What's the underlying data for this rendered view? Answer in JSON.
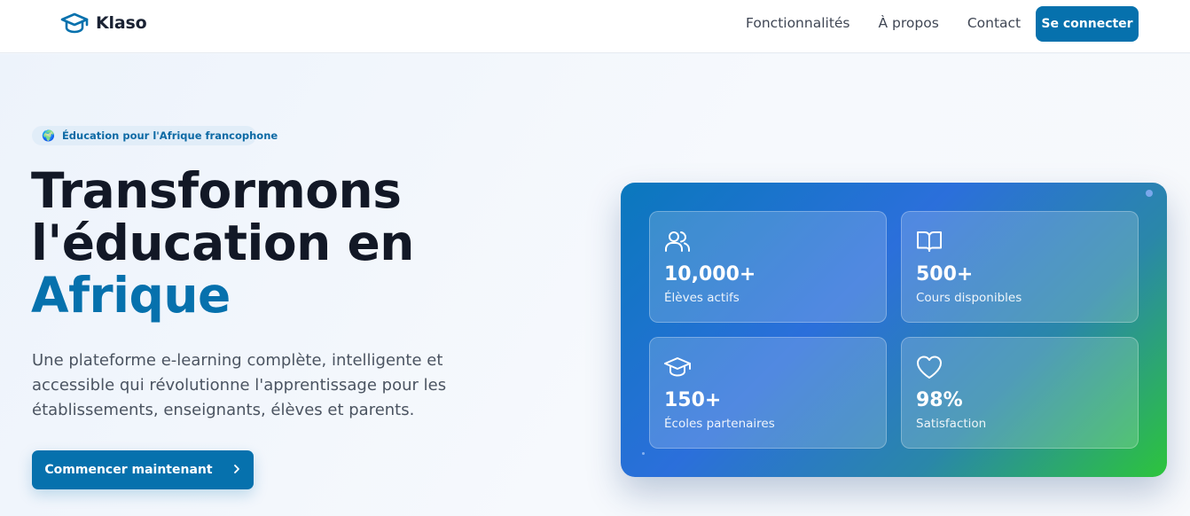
{
  "nav": {
    "brand": "Klaso",
    "links": [
      "Fonctionnalités",
      "À propos",
      "Contact"
    ],
    "login_label": "Se connecter"
  },
  "hero": {
    "badge_icon": "🌍",
    "badge_text": "Éducation pour l'Afrique francophone",
    "title_line1": "Transformons",
    "title_line2": "l'éducation en",
    "title_accent": "Afrique",
    "subtitle": "Une plateforme e-learning complète, intelligente et accessible qui révolutionne l'apprentissage pour les établissements, enseignants, élèves et parents.",
    "cta_label": "Commencer maintenant",
    "cta_icon": "chevron-right-icon"
  },
  "stats": [
    {
      "icon": "users-icon",
      "value": "10,000+",
      "label": "Élèves actifs"
    },
    {
      "icon": "book-open-icon",
      "value": "500+",
      "label": "Cours disponibles"
    },
    {
      "icon": "graduation-cap-icon",
      "value": "150+",
      "label": "Écoles partenaires"
    },
    {
      "icon": "heart-icon",
      "value": "98%",
      "label": "Satisfaction"
    }
  ],
  "colors": {
    "primary": "#0671ad",
    "title": "#121826",
    "card_gradient_start": "#0a78bd",
    "card_gradient_mid": "#2b6fdb",
    "card_gradient_end": "#2dc43c"
  }
}
